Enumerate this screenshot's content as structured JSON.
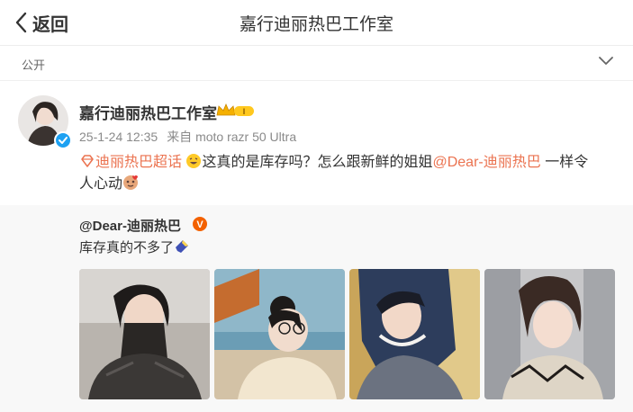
{
  "header": {
    "back_label": "返回",
    "title": "嘉行迪丽热巴工作室"
  },
  "visibility": {
    "label": "公开"
  },
  "post": {
    "author": "嘉行迪丽热巴工作室",
    "time": "25-1-24 12:35",
    "source": "来自 moto razr 50 Ultra",
    "topic_link": "迪丽热巴超话",
    "text_part1": "这真的是库存吗？怎么跟新鲜的姐姐",
    "mention": "@Dear-迪丽热巴",
    "text_part2": " 一样令",
    "text_line2": "人心动"
  },
  "repost": {
    "author": "@Dear-迪丽热巴",
    "text": "库存真的不多了",
    "photos": [
      "photo-1",
      "photo-2",
      "photo-3",
      "photo-4"
    ]
  },
  "colors": {
    "link": "#eb7350",
    "verified_blue": "#1da1f2",
    "verified_orange": "#f36100",
    "repost_bg": "#f8f8f8"
  },
  "icons": {
    "back": "chevron-left-icon",
    "expand": "chevron-down-icon",
    "crown": "crown-badge-icon",
    "topic": "diamond-topic-icon",
    "verified": "verified-check-icon"
  }
}
